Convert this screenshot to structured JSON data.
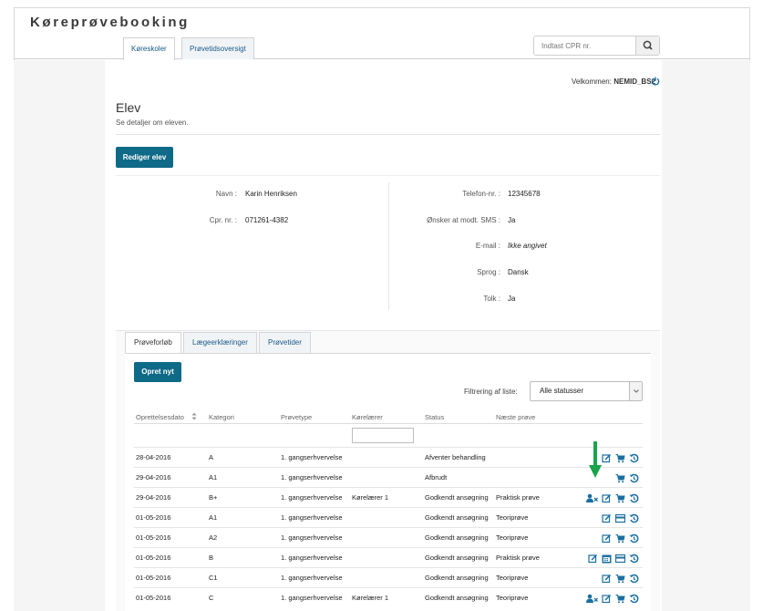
{
  "app": {
    "title": "Køreprøvebooking"
  },
  "nav": {
    "tabs": [
      {
        "label": "Køreskoler"
      },
      {
        "label": "Prøvetidsoversigt"
      }
    ]
  },
  "search": {
    "placeholder": "Indtast CPR nr."
  },
  "user": {
    "welcome_prefix": "Velkommen:",
    "username": "NEMID_BS2"
  },
  "page": {
    "title": "Elev",
    "subtitle": "Se detaljer om eleven.",
    "edit_button": "Rediger elev"
  },
  "student": {
    "left": [
      {
        "label": "Navn :",
        "value": "Karin Henriksen"
      },
      {
        "label": "Cpr. nr. :",
        "value": "071261-4382"
      }
    ],
    "right": [
      {
        "label": "Telefon-nr. :",
        "value": "12345678"
      },
      {
        "label": "Ønsker at modt. SMS :",
        "value": "Ja"
      },
      {
        "label": "E-mail :",
        "value": "Ikke angivet"
      },
      {
        "label": "Sprog :",
        "value": "Dansk"
      },
      {
        "label": "Tolk :",
        "value": "Ja"
      }
    ]
  },
  "tabs": [
    {
      "label": "Prøveforløb"
    },
    {
      "label": "Lægeerklæringer"
    },
    {
      "label": "Prøvetider"
    }
  ],
  "panel": {
    "create_button": "Opret nyt",
    "filter_label": "Filtrering af liste:",
    "filter_value": "Alle statusser"
  },
  "table": {
    "headers": [
      "Oprettelsesdato",
      "Kategori",
      "Prøvetype",
      "Kørelærer",
      "Status",
      "Næste prøve"
    ],
    "rows": [
      {
        "date": "28-04-2016",
        "category": "A",
        "type": "1. gangserhvervelse",
        "teacher": "",
        "status": "Afventer behandling",
        "next": "",
        "icons": [
          "edit-icon",
          "cart-icon",
          "history-icon"
        ]
      },
      {
        "date": "29-04-2016",
        "category": "A1",
        "type": "1. gangserhvervelse",
        "teacher": "",
        "status": "Afbrudt",
        "next": "",
        "icons": [
          "cart-icon",
          "history-icon"
        ]
      },
      {
        "date": "29-04-2016",
        "category": "B+",
        "type": "1. gangserhvervelse",
        "teacher": "Kørelærer 1",
        "status": "Godkendt ansøgning",
        "next": "Praktisk prøve",
        "icons": [
          "user-remove-icon",
          "edit-icon",
          "cart-icon",
          "history-icon"
        ]
      },
      {
        "date": "01-05-2016",
        "category": "A1",
        "type": "1. gangserhvervelse",
        "teacher": "",
        "status": "Godkendt ansøgning",
        "next": "Teoriprøve",
        "icons": [
          "edit-icon",
          "card-icon",
          "history-icon"
        ]
      },
      {
        "date": "01-05-2016",
        "category": "A2",
        "type": "1. gangserhvervelse",
        "teacher": "",
        "status": "Godkendt ansøgning",
        "next": "Teoriprøve",
        "icons": [
          "edit-icon",
          "cart-icon",
          "history-icon"
        ]
      },
      {
        "date": "01-05-2016",
        "category": "B",
        "type": "1. gangserhvervelse",
        "teacher": "",
        "status": "Godkendt ansøgning",
        "next": "Praktisk prøve",
        "icons": [
          "edit-icon",
          "calendar-icon",
          "card-icon",
          "history-icon"
        ]
      },
      {
        "date": "01-05-2016",
        "category": "C1",
        "type": "1. gangserhvervelse",
        "teacher": "",
        "status": "Godkendt ansøgning",
        "next": "Teoriprøve",
        "icons": [
          "edit-icon",
          "cart-icon",
          "history-icon"
        ]
      },
      {
        "date": "01-05-2016",
        "category": "C",
        "type": "1. gangserhvervelse",
        "teacher": "Kørelærer 1",
        "status": "Godkendt ansøgning",
        "next": "Teoriprøve",
        "icons": [
          "user-remove-icon",
          "edit-icon",
          "cart-icon",
          "history-icon"
        ]
      }
    ]
  },
  "colors": {
    "primary": "#0f6a87",
    "link": "#1a5a87",
    "arrow": "#1aa34a",
    "icon": "#1a6fa0"
  }
}
